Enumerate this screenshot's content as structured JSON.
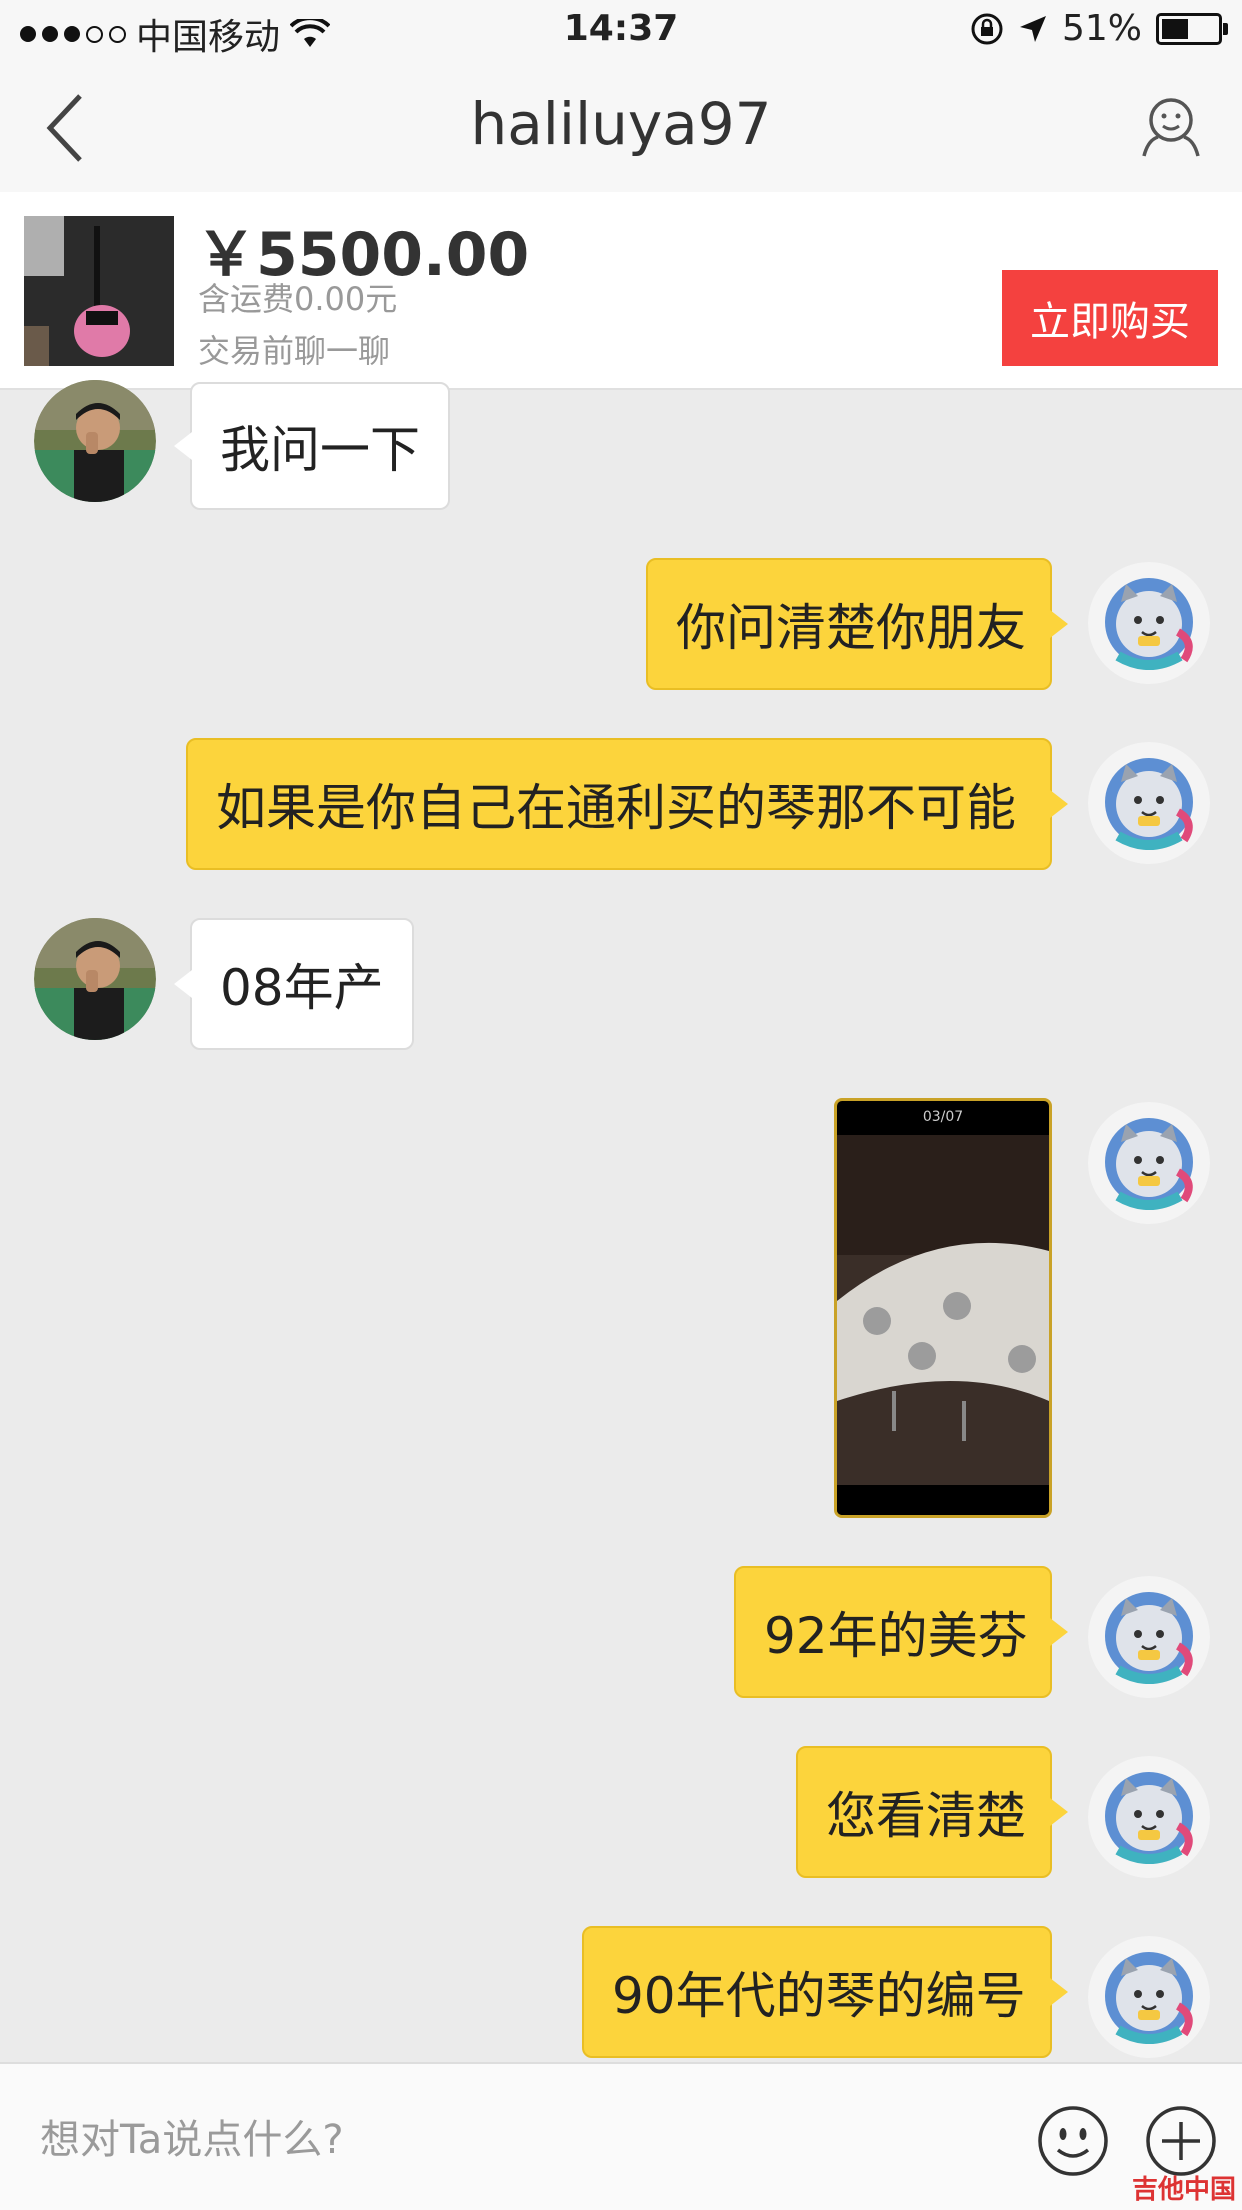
{
  "status_bar": {
    "carrier": "中国移动",
    "time": "14:37",
    "battery": "51%"
  },
  "nav": {
    "title": "haliluya97"
  },
  "product": {
    "price": "￥5500.00",
    "shipping": "含运费0.00元",
    "note": "交易前聊一聊",
    "buy_label": "立即购买"
  },
  "messages": [
    {
      "side": "in",
      "text": "我问一下"
    },
    {
      "side": "out",
      "text": "你问清楚你朋友"
    },
    {
      "side": "out",
      "text": "如果是你自己在通利买的琴那不可能"
    },
    {
      "side": "in",
      "text": "08年产"
    },
    {
      "side": "out",
      "type": "image",
      "counter": "03/07"
    },
    {
      "side": "out",
      "text": "92年的美芬"
    },
    {
      "side": "out",
      "text": "您看清楚"
    },
    {
      "side": "out",
      "text": "90年代的琴的编号"
    }
  ],
  "input": {
    "placeholder": "想对Ta说点什么?"
  },
  "watermark": "吉他中国"
}
